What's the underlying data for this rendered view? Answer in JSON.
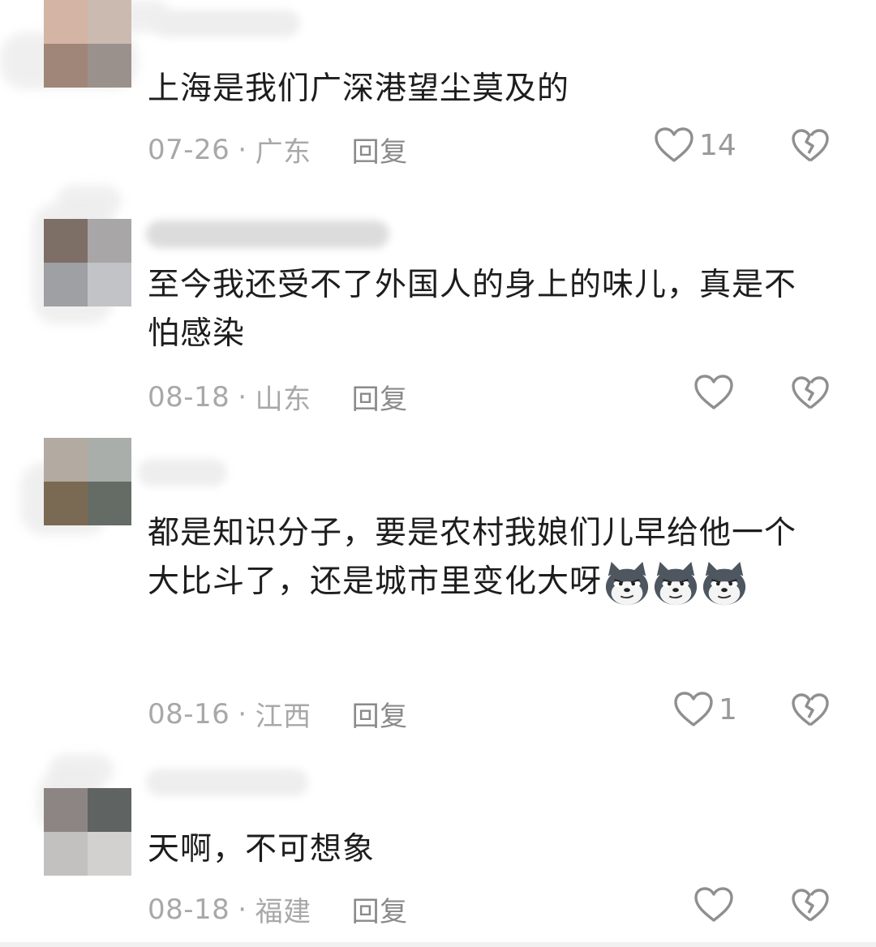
{
  "comments": [
    {
      "text": "上海是我们广深港望尘莫及的",
      "date": "07-26",
      "region": "广东",
      "reply_label": "回复",
      "likes": "14",
      "avatar_colors": [
        "#d4b4a4",
        "#cbbab0",
        "#a08678",
        "#9b918c"
      ]
    },
    {
      "text": "至今我还受不了外国人的身上的味儿，真是不怕感染",
      "date": "08-18",
      "region": "山东",
      "reply_label": "回复",
      "likes": "",
      "avatar_colors": [
        "#7d6e66",
        "#a8a6a6",
        "#9fa0a4",
        "#c1c3c6"
      ]
    },
    {
      "text": "都是知识分子，要是农村我娘们儿早给他一个大比斗了，还是城市里变化大呀",
      "date": "08-16",
      "region": "江西",
      "reply_label": "回复",
      "likes": "1",
      "avatar_colors": [
        "#b3aaa1",
        "#a9aeab",
        "#7a6a53",
        "#656b65"
      ]
    },
    {
      "text": "天啊，不可想象",
      "date": "08-18",
      "region": "福建",
      "reply_label": "回复",
      "likes": "",
      "avatar_colors": [
        "#8d8583",
        "#5f6462",
        "#c3c1c0",
        "#d2d1d0"
      ]
    }
  ],
  "emoji_name": "dog-emoji",
  "colors": {
    "text": "#1d1d1d",
    "meta": "#a8a8a8",
    "icon": "#8f8f8f"
  }
}
